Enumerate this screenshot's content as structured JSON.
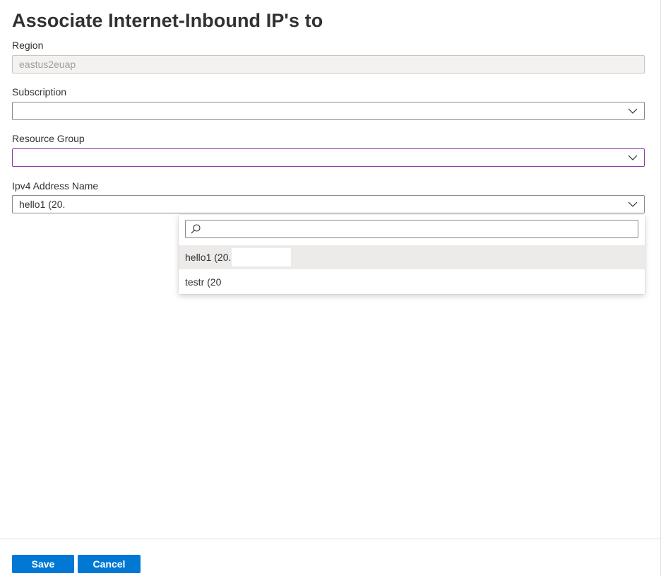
{
  "panel": {
    "title": "Associate Internet-Inbound IP's to"
  },
  "form": {
    "region": {
      "label": "Region",
      "value": "eastus2euap"
    },
    "subscription": {
      "label": "Subscription",
      "value": ""
    },
    "resource_group": {
      "label": "Resource Group",
      "value": ""
    },
    "ipv4": {
      "label": "Ipv4 Address Name",
      "value": "hello1 (20."
    }
  },
  "dropdown": {
    "search_value": "",
    "options": [
      {
        "label": "hello1 (20.",
        "highlighted": true
      },
      {
        "label": "testr (20",
        "highlighted": false
      }
    ]
  },
  "footer": {
    "save_label": "Save",
    "cancel_label": "Cancel"
  },
  "colors": {
    "primary": "#0078d4",
    "focus_border": "#8a3aa8",
    "highlight": "#edebe9"
  },
  "icons": {
    "dropdown": "chevron-down-icon",
    "search": "search-icon"
  }
}
